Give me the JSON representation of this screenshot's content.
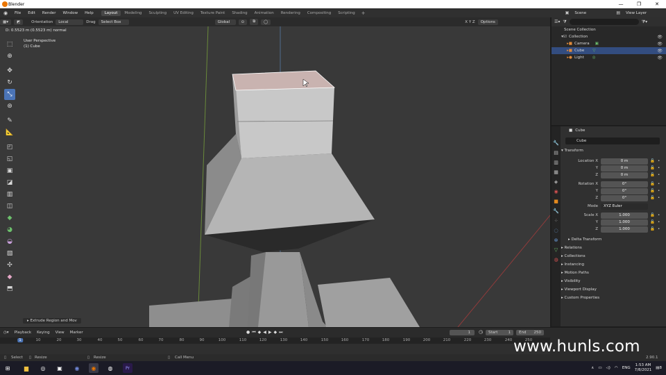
{
  "window": {
    "title": "Blender",
    "controls": [
      "—",
      "❐",
      "✕"
    ]
  },
  "menu": {
    "items": [
      "File",
      "Edit",
      "Render",
      "Window",
      "Help"
    ],
    "workspaces": [
      "Layout",
      "Modeling",
      "Sculpting",
      "UV Editing",
      "Texture Paint",
      "Shading",
      "Animation",
      "Rendering",
      "Compositing",
      "Scripting"
    ],
    "add_workspace": "+",
    "scene": "Scene",
    "view_layer": "View Layer"
  },
  "viewport_header": {
    "orientation_label": "Orientation",
    "orientation_value": "Local",
    "drag_label": "Drag",
    "drag_value": "Select Box",
    "transform_orientation": "Global",
    "options": "Options",
    "axes": "X Y Z"
  },
  "viewport": {
    "status_text": "D: 0.5523 m (0.5523 m) normal",
    "perspective": "User Perspective",
    "object_info": "(1) Cube",
    "operator_panel": "Extrude Region and Mov"
  },
  "toolbar": {
    "tools": [
      "select-box",
      "cursor",
      "move",
      "rotate",
      "scale",
      "transform",
      "annotate",
      "measure",
      "extrude-region",
      "extrude-manifold",
      "inset-faces",
      "bevel",
      "loop-cut",
      "knife",
      "poly-build",
      "spin",
      "smooth",
      "edge-slide",
      "shrink-fatten",
      "shear",
      "rip-region"
    ],
    "active_tool": "scale"
  },
  "outliner": {
    "rows": [
      {
        "label": "Scene Collection",
        "indent": 0,
        "icon": "scene-collection-icon",
        "selected": false,
        "eye": false
      },
      {
        "label": "Collection",
        "indent": 1,
        "icon": "collection-icon",
        "selected": false,
        "eye": true
      },
      {
        "label": "Camera",
        "indent": 2,
        "icon": "camera-icon",
        "selected": false,
        "eye": true
      },
      {
        "label": "Cube",
        "indent": 2,
        "icon": "mesh-icon",
        "selected": true,
        "eye": true
      },
      {
        "label": "Light",
        "indent": 2,
        "icon": "light-icon",
        "selected": false,
        "eye": true
      }
    ]
  },
  "properties": {
    "header_object": "Cube",
    "object_name": "Cube",
    "transform_title": "Transform",
    "location": {
      "label": "Location X",
      "x": "0 m",
      "y": "0 m",
      "z": "0 m"
    },
    "rotation": {
      "label": "Rotation X",
      "x": "0°",
      "y": "0°",
      "z": "0°"
    },
    "mode": {
      "label": "Mode",
      "value": "XYZ Euler"
    },
    "scale": {
      "label": "Scale X",
      "x": "1.000",
      "y": "1.000",
      "z": "1.000"
    },
    "axis_y": "Y",
    "axis_z": "Z",
    "delta_transform": "Delta Transform",
    "sections": [
      "Relations",
      "Collections",
      "Instancing",
      "Motion Paths",
      "Visibility",
      "Viewport Display",
      "Custom Properties"
    ]
  },
  "timeline": {
    "menus": [
      "Playback",
      "Keying",
      "View",
      "Marker"
    ],
    "current_frame": "1",
    "start_label": "Start",
    "start_value": "1",
    "end_label": "End",
    "end_value": "250",
    "ruler": [
      "1",
      "10",
      "20",
      "30",
      "40",
      "50",
      "60",
      "70",
      "80",
      "90",
      "100",
      "110",
      "120",
      "130",
      "140",
      "150",
      "160",
      "170",
      "180",
      "190",
      "200",
      "210",
      "220",
      "230",
      "240",
      "250"
    ]
  },
  "statusbar": {
    "select": "Select",
    "resize": "Resize",
    "resize2": "Resize",
    "context": "Call Menu",
    "version": "2.90.1"
  },
  "taskbar": {
    "lang": "ENG",
    "time": "1:53 AM",
    "date": "7/8/2021",
    "notifications": "8"
  },
  "watermark": "www.hunls.com",
  "colors": {
    "accent": "#4b74b6",
    "selection": "#334d80",
    "orange": "#ea7600"
  }
}
